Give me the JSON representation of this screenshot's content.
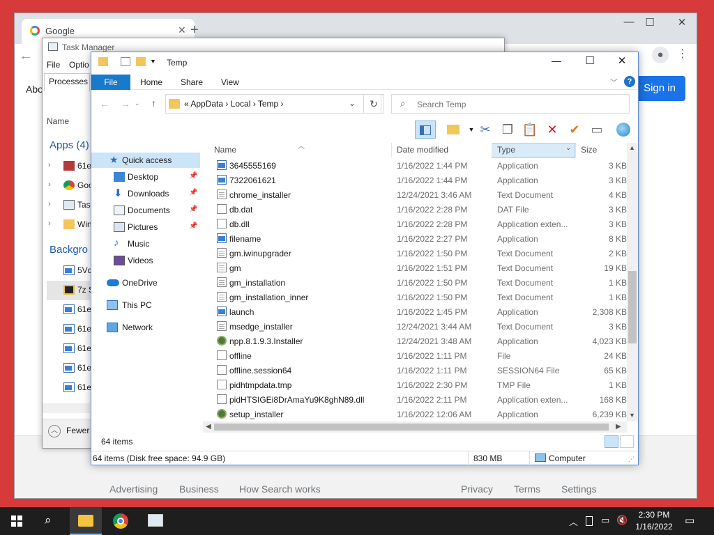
{
  "chrome": {
    "tab_title": "Google",
    "tab_close": "✕",
    "new_tab": "+",
    "about_link": "Abo",
    "signin_label": "Sign in",
    "footer_links": [
      "Advertising",
      "Business",
      "How Search works",
      "Privacy",
      "Terms",
      "Settings"
    ]
  },
  "task_manager": {
    "title": "Task Manager",
    "menu_file": "File",
    "menu_options": "Optio",
    "tab_processes": "Processes",
    "col_name": "Name",
    "group_apps": "Apps (4)",
    "group_background": "Backgro",
    "app_rows": [
      "61e",
      "Goo",
      "Task",
      "Win"
    ],
    "bg_rows": [
      "5Vq",
      "7z S",
      "61e",
      "61e",
      "61e",
      "61e",
      "61e"
    ],
    "fewer_details": "Fewer"
  },
  "explorer": {
    "title": "Temp",
    "ribbon_tabs": {
      "file": "File",
      "home": "Home",
      "share": "Share",
      "view": "View"
    },
    "address": "«  AppData  ›  Local  ›  Temp  ›",
    "search_placeholder": "Search Temp",
    "nav": {
      "quick_access": "Quick access",
      "desktop": "Desktop",
      "downloads": "Downloads",
      "documents": "Documents",
      "pictures": "Pictures",
      "music": "Music",
      "videos": "Videos",
      "onedrive": "OneDrive",
      "this_pc": "This PC",
      "network": "Network"
    },
    "columns": {
      "name": "Name",
      "date": "Date modified",
      "type": "Type",
      "size": "Size"
    },
    "files": [
      {
        "name": "3645555169",
        "date": "1/16/2022 1:44 PM",
        "type": "Application",
        "size": "3 KB",
        "icon": "app"
      },
      {
        "name": "7322061621",
        "date": "1/16/2022 1:44 PM",
        "type": "Application",
        "size": "3 KB",
        "icon": "app"
      },
      {
        "name": "chrome_installer",
        "date": "12/24/2021 3:46 AM",
        "type": "Text Document",
        "size": "4 KB",
        "icon": "doc"
      },
      {
        "name": "db.dat",
        "date": "1/16/2022 2:28 PM",
        "type": "DAT File",
        "size": "3 KB",
        "icon": "blank"
      },
      {
        "name": "db.dll",
        "date": "1/16/2022 2:28 PM",
        "type": "Application exten...",
        "size": "3 KB",
        "icon": "blank"
      },
      {
        "name": "filename",
        "date": "1/16/2022 2:27 PM",
        "type": "Application",
        "size": "8 KB",
        "icon": "app"
      },
      {
        "name": "gm.iwinupgrader",
        "date": "1/16/2022 1:50 PM",
        "type": "Text Document",
        "size": "2 KB",
        "icon": "doc"
      },
      {
        "name": "gm",
        "date": "1/16/2022 1:51 PM",
        "type": "Text Document",
        "size": "19 KB",
        "icon": "doc"
      },
      {
        "name": "gm_installation",
        "date": "1/16/2022 1:50 PM",
        "type": "Text Document",
        "size": "1 KB",
        "icon": "doc"
      },
      {
        "name": "gm_installation_inner",
        "date": "1/16/2022 1:50 PM",
        "type": "Text Document",
        "size": "1 KB",
        "icon": "doc"
      },
      {
        "name": "launch",
        "date": "1/16/2022 1:45 PM",
        "type": "Application",
        "size": "2,308 KB",
        "icon": "app"
      },
      {
        "name": "msedge_installer",
        "date": "12/24/2021 3:44 AM",
        "type": "Text Document",
        "size": "3 KB",
        "icon": "doc"
      },
      {
        "name": "npp.8.1.9.3.Installer",
        "date": "12/24/2021 3:48 AM",
        "type": "Application",
        "size": "4,023 KB",
        "icon": "gear"
      },
      {
        "name": "offline",
        "date": "1/16/2022 1:11 PM",
        "type": "File",
        "size": "24 KB",
        "icon": "blank"
      },
      {
        "name": "offline.session64",
        "date": "1/16/2022 1:11 PM",
        "type": "SESSION64 File",
        "size": "65 KB",
        "icon": "blank"
      },
      {
        "name": "pidhtmpdata.tmp",
        "date": "1/16/2022 2:30 PM",
        "type": "TMP File",
        "size": "1 KB",
        "icon": "blank"
      },
      {
        "name": "pidHTSIGEi8DrAmaYu9K8ghN89.dll",
        "date": "1/16/2022 2:11 PM",
        "type": "Application exten...",
        "size": "168 KB",
        "icon": "blank"
      },
      {
        "name": "setup_installer",
        "date": "1/16/2022 12:06 AM",
        "type": "Application",
        "size": "6,239 KB",
        "icon": "gear"
      }
    ],
    "item_count": "64 items",
    "status_items": "64 items (Disk free space: 94.9 GB)",
    "status_size": "830 MB",
    "status_location": "Computer"
  },
  "taskbar": {
    "time": "2:30 PM",
    "date": "1/16/2022"
  }
}
